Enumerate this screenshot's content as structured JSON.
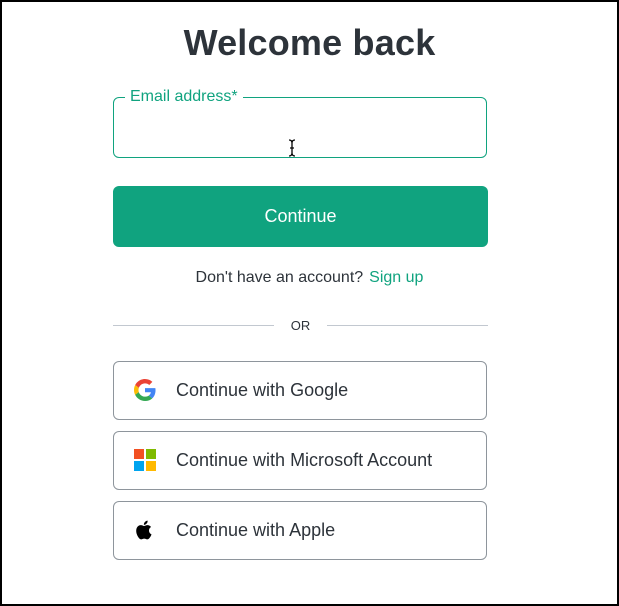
{
  "page": {
    "title": "Welcome back"
  },
  "email": {
    "label": "Email address*",
    "value": "",
    "placeholder": ""
  },
  "continue_button": {
    "label": "Continue"
  },
  "signup": {
    "prompt": "Don't have an account?",
    "link": "Sign up"
  },
  "divider": {
    "text": "OR"
  },
  "social": [
    {
      "label": "Continue with Google",
      "icon": "google-icon"
    },
    {
      "label": "Continue with Microsoft Account",
      "icon": "microsoft-icon"
    },
    {
      "label": "Continue with Apple",
      "icon": "apple-icon"
    }
  ],
  "colors": {
    "accent": "#10a37f",
    "text": "#2d333a",
    "border": "#8e959c",
    "divider": "#c2c8d0"
  }
}
